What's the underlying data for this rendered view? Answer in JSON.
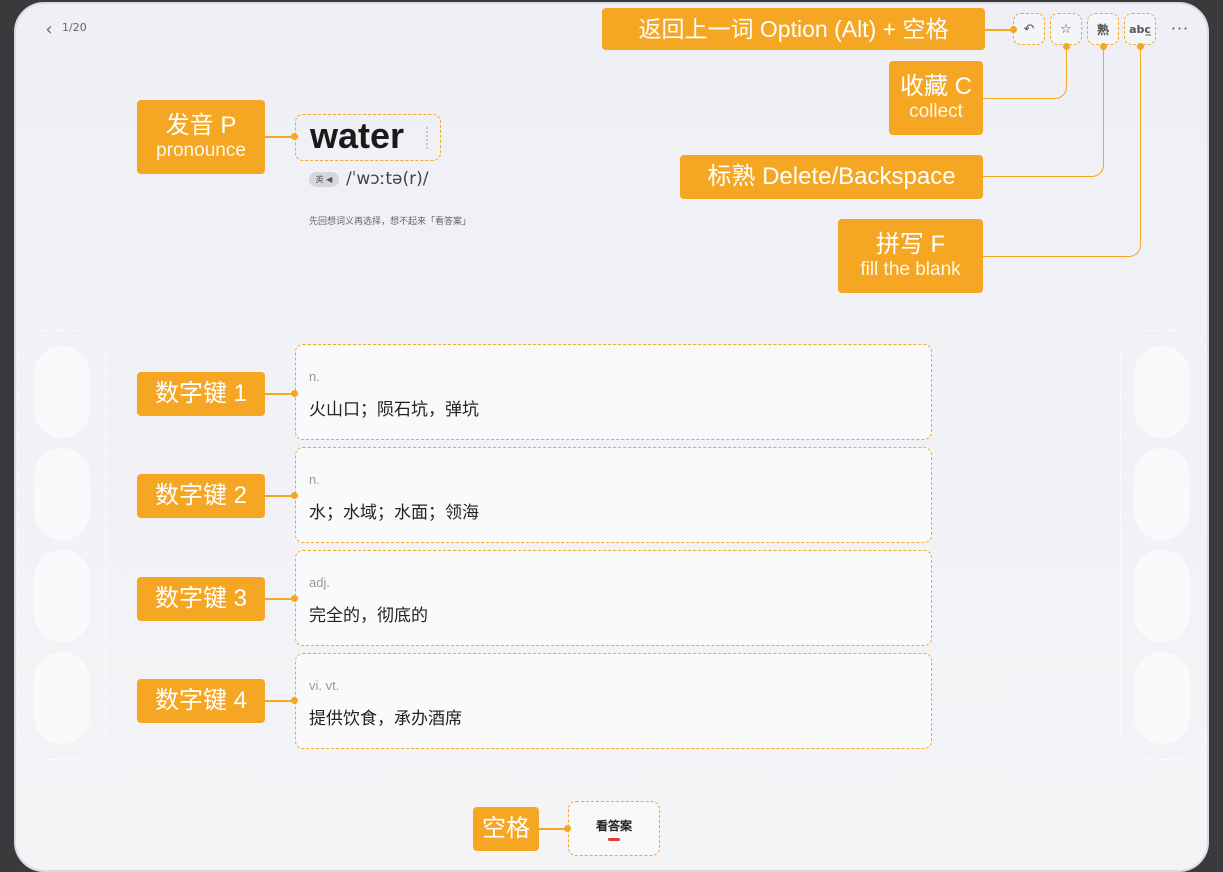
{
  "topbar": {
    "back_icon": "chevron-left-icon",
    "progress": "1/20",
    "tools": [
      {
        "name": "undo-icon",
        "glyph": "↶"
      },
      {
        "name": "star-icon",
        "glyph": "☆"
      },
      {
        "name": "mastered-icon",
        "glyph": "熟"
      },
      {
        "name": "spell-icon",
        "glyph": "abc̲"
      }
    ],
    "more_glyph": "···"
  },
  "word": {
    "text": "water",
    "accent_label": "英 ◀",
    "phonetic": "/ˈwɔːtə(r)/",
    "hint": "先回想词义再选择，想不起来「看答案」"
  },
  "definitions": [
    {
      "pos": "n.",
      "meaning": "火山口；陨石坑，弹坑"
    },
    {
      "pos": "n.",
      "meaning": "水；水域；水面；领海"
    },
    {
      "pos": "adj.",
      "meaning": "完全的，彻底的"
    },
    {
      "pos": "vi. vt.",
      "meaning": "提供饮食，承办酒席"
    }
  ],
  "answer_button": {
    "label": "看答案"
  },
  "callouts": {
    "undo": "返回上一词 Option (Alt) + 空格",
    "collect_main": "收藏 C",
    "collect_sub": "collect",
    "mastered": "标熟 Delete/Backspace",
    "spell_main": "拼写 F",
    "spell_sub": "fill the blank",
    "pronounce_main": "发音 P",
    "pronounce_sub": "pronounce",
    "key1": "数字键 1",
    "key2": "数字键 2",
    "key3": "数字键 3",
    "key4": "数字键 4",
    "space": "空格"
  },
  "colors": {
    "accent": "#f5a623",
    "answer_bar": "#e53935"
  }
}
